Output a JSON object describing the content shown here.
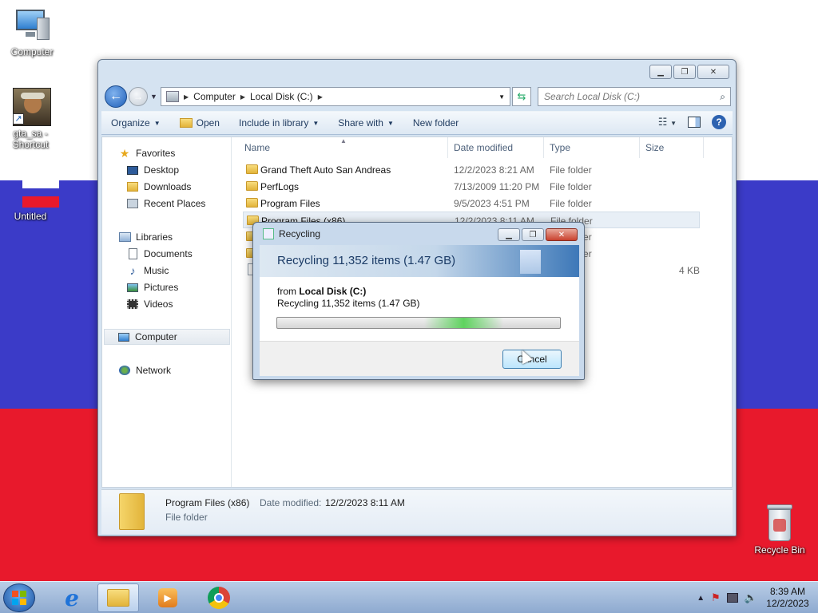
{
  "desktop": {
    "icons": [
      {
        "label": "Computer"
      },
      {
        "label": "gta_sa -\nShortcut"
      },
      {
        "label": "Untitled"
      },
      {
        "label": "Recycle Bin"
      }
    ]
  },
  "explorer": {
    "address": {
      "crumbs": [
        "Computer",
        "Local Disk (C:)"
      ]
    },
    "search_placeholder": "Search Local Disk (C:)",
    "toolbar": {
      "organize": "Organize",
      "open": "Open",
      "include": "Include in library",
      "share": "Share with",
      "new_folder": "New folder"
    },
    "nav": {
      "favorites": "Favorites",
      "desktop": "Desktop",
      "downloads": "Downloads",
      "recent": "Recent Places",
      "libraries": "Libraries",
      "documents": "Documents",
      "music": "Music",
      "pictures": "Pictures",
      "videos": "Videos",
      "computer": "Computer",
      "network": "Network"
    },
    "columns": {
      "name": "Name",
      "date": "Date modified",
      "type": "Type",
      "size": "Size"
    },
    "rows": [
      {
        "name": "Grand Theft Auto San Andreas",
        "date": "12/2/2023 8:21 AM",
        "type": "File folder",
        "size": ""
      },
      {
        "name": "PerfLogs",
        "date": "7/13/2009 11:20 PM",
        "type": "File folder",
        "size": ""
      },
      {
        "name": "Program Files",
        "date": "9/5/2023 4:51 PM",
        "type": "File folder",
        "size": ""
      },
      {
        "name": "Program Files (x86)",
        "date": "12/2/2023 8:11 AM",
        "type": "File folder",
        "size": ""
      },
      {
        "name": "",
        "date": "",
        "type": "File folder",
        "size": ""
      },
      {
        "name": "",
        "date": "",
        "type": "File folder",
        "size": ""
      },
      {
        "name": "",
        "date": "",
        "type": "",
        "size": "4 KB"
      }
    ],
    "details": {
      "name": "Program Files (x86)",
      "date_label": "Date modified:",
      "date_value": "12/2/2023 8:11 AM",
      "type": "File folder"
    }
  },
  "dialog": {
    "title": "Recycling",
    "heading": "Recycling 11,352 items (1.47 GB)",
    "from_label": "from",
    "from_value": "Local Disk (C:)",
    "detail": "Recycling 11,352 items (1.47 GB)",
    "cancel": "Cancel"
  },
  "taskbar": {
    "time": "8:39 AM",
    "date": "12/2/2023"
  }
}
